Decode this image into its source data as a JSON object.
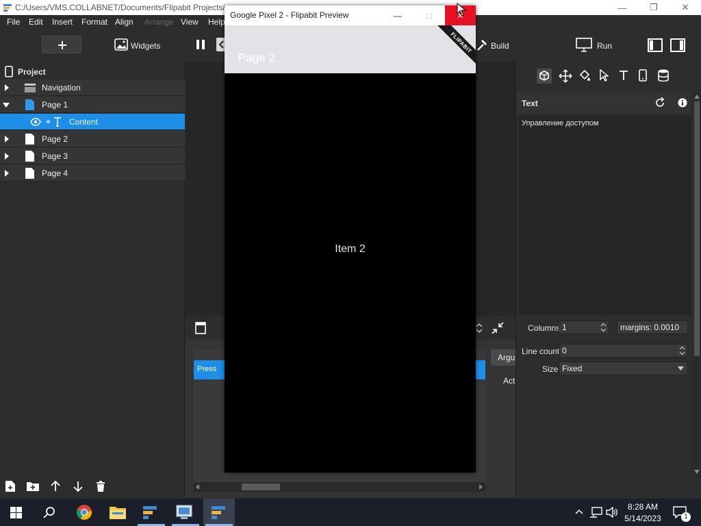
{
  "titlebar": {
    "path": "C:/Users/VMS.COLLABNET/Documents/Flipabit Projects/a"
  },
  "menu": [
    "File",
    "Edit",
    "Insert",
    "Format",
    "Align",
    "Arrange",
    "View",
    "Help"
  ],
  "toolbar": {
    "widgets_label": "Widgets",
    "build_label": "Build",
    "run_label": "Run"
  },
  "project": {
    "title": "Project",
    "items": [
      {
        "label": "Navigation"
      },
      {
        "label": "Page 1"
      },
      {
        "label": "Content"
      },
      {
        "label": "Page 2"
      },
      {
        "label": "Page 3"
      },
      {
        "label": "Page 4"
      }
    ]
  },
  "bottom": {
    "press_label": "Press",
    "argu_label": "Argu",
    "act_label": "Act"
  },
  "properties": {
    "title": "Text",
    "text_value": "Управление доступом",
    "columns_label": "Columns",
    "columns_value": "1",
    "margins_value": "margins: 0.0010",
    "line_count_label": "Line count",
    "line_count_value": "0",
    "size_label": "Size",
    "size_value": "Fixed"
  },
  "preview": {
    "window_title": "Google Pixel 2 - Flipabit Preview",
    "page_header": "Page 2",
    "ribbon": "FLIPABIT",
    "content": "Item 2"
  },
  "taskbar": {
    "time": "8:28 AM",
    "date": "5/14/2023",
    "notif_count": "1"
  },
  "colors": {
    "accent": "#1e8fe8",
    "close_red": "#e81123"
  }
}
